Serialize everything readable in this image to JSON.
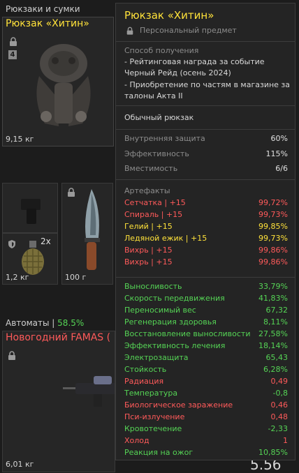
{
  "inventory": {
    "category_label": "Рюкзаки и сумки",
    "backpack": {
      "name": "Рюкзак «Хитин»",
      "count_badge": "4",
      "weight": "9,15 кг"
    },
    "grenade": {
      "count": "2x",
      "weight": "1,2 кг"
    },
    "knife": {
      "weight": "100 г"
    },
    "rifle_category": {
      "label": "Автоматы |",
      "percent": "58.5%"
    },
    "rifle": {
      "name": "Новогодний FAMAS (",
      "weight": "6,01 кг"
    },
    "corner_number": "5.56"
  },
  "tooltip": {
    "title": "Рюкзак «Хитин»",
    "personal_label": "Персональный предмет",
    "obtain_header": "Способ получения",
    "obtain_lines": [
      "- Рейтинговая награда за событие",
      "Черный Рейд (осень 2024)",
      "- Приобретение по частям в магазине за",
      "талоны Акта II"
    ],
    "type_label": "Обычный рюкзак",
    "stats": [
      {
        "label": "Внутренняя защита",
        "value": "60%"
      },
      {
        "label": "Эффективность",
        "value": "115%"
      },
      {
        "label": "Вместимость",
        "value": "6/6"
      }
    ],
    "artifacts_header": "Артефакты",
    "artifacts": [
      {
        "label": "Сетчатка | +15",
        "value": "99,72%",
        "color": "#ff5a5a"
      },
      {
        "label": "Спираль | +15",
        "value": "99,73%",
        "color": "#ff5a5a"
      },
      {
        "label": "Гелий | +15",
        "value": "99,85%",
        "color": "#ffe23a"
      },
      {
        "label": "Ледяной ежик | +15",
        "value": "99,73%",
        "color": "#ffe23a"
      },
      {
        "label": "Вихрь | +15",
        "value": "99,86%",
        "color": "#ff5a5a"
      },
      {
        "label": "Вихрь | +15",
        "value": "99,86%",
        "color": "#ff5a5a"
      }
    ],
    "bonuses": [
      {
        "label": "Выносливость",
        "value": "33,79%",
        "color": "#55d455"
      },
      {
        "label": "Скорость передвижения",
        "value": "41,83%",
        "color": "#55d455"
      },
      {
        "label": "Переносимый вес",
        "value": "67,32",
        "color": "#55d455"
      },
      {
        "label": "Регенерация здоровья",
        "value": "8,11%",
        "color": "#55d455"
      },
      {
        "label": "Восстановление выносливости",
        "value": "27,58%",
        "color": "#55d455"
      },
      {
        "label": "Эффективность лечения",
        "value": "18,14%",
        "color": "#55d455"
      },
      {
        "label": "Электрозащита",
        "value": "65,43",
        "color": "#55d455"
      },
      {
        "label": "Стойкость",
        "value": "6,28%",
        "color": "#55d455"
      },
      {
        "label": "Радиация",
        "value": "0,49",
        "color": "#ff5a5a"
      },
      {
        "label": "Температура",
        "value": "-0,8",
        "color": "#55d455"
      },
      {
        "label": "Биологическое заражение",
        "value": "0,46",
        "color": "#ff5a5a"
      },
      {
        "label": "Пси-излучение",
        "value": "0,48",
        "color": "#ff5a5a"
      },
      {
        "label": "Кровотечение",
        "value": "-2,33",
        "color": "#55d455"
      },
      {
        "label": "Холод",
        "value": "1",
        "color": "#ff5a5a"
      },
      {
        "label": "Реакция на ожог",
        "value": "10,85%",
        "color": "#55d455"
      }
    ]
  },
  "colors": {
    "title_yellow": "#ffe23a",
    "rifle_red": "#ff5a5a",
    "percent_green": "#55d455"
  }
}
